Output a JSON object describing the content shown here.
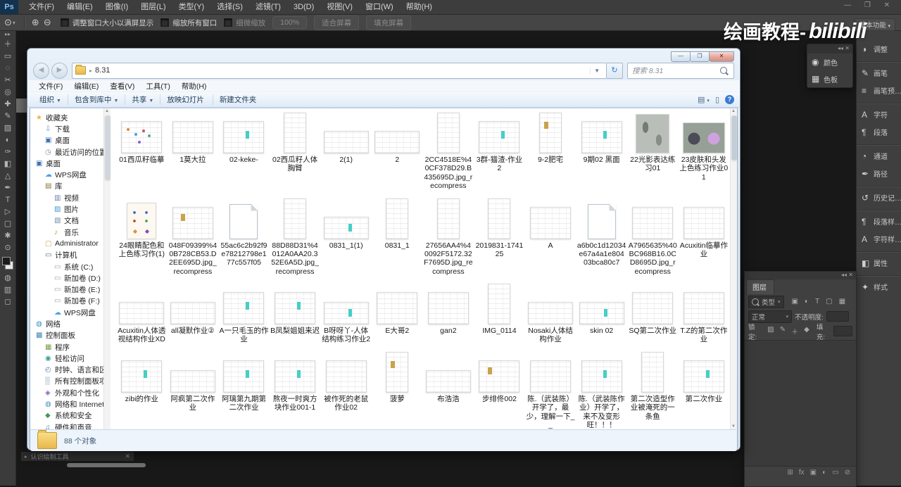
{
  "ps": {
    "logo": "Ps",
    "menus": [
      "文件(F)",
      "编辑(E)",
      "图像(I)",
      "图层(L)",
      "类型(Y)",
      "选择(S)",
      "滤镜(T)",
      "3D(D)",
      "视图(V)",
      "窗口(W)",
      "帮助(H)"
    ],
    "window_controls": "— ❐ ✕",
    "options": {
      "zoom_tool_icon": "⊙",
      "fit_window_label": "调整窗口大小以满屏显示",
      "zoom_all_label": "缩放所有窗口",
      "scrubby_label": "细微缩放",
      "btn_100": "100%",
      "btn_fit": "适合屏幕",
      "btn_fill": "填充屏幕"
    },
    "workspace": "基本功能",
    "tools_top": [
      "＋",
      "▭",
      "◌",
      "✂",
      "◎",
      "✚",
      "✎",
      "▨",
      "◐",
      "✑",
      "◧",
      "△",
      "✒",
      "T",
      "▷",
      "▢",
      "✱",
      "⊙"
    ],
    "tools_bottom": [
      "◍",
      "▥",
      "◻"
    ],
    "dock": [
      {
        "label": "调整",
        "glyph": "◑",
        "c": ""
      },
      {
        "label": "画笔",
        "glyph": "✎",
        "c": "sep"
      },
      {
        "label": "画笔预…",
        "glyph": "≡",
        "c": ""
      },
      {
        "label": "字符",
        "glyph": "A",
        "c": "sep"
      },
      {
        "label": "段落",
        "glyph": "¶",
        "c": ""
      },
      {
        "label": "通道",
        "glyph": "◔",
        "c": "sep"
      },
      {
        "label": "路径",
        "glyph": "✒",
        "c": ""
      },
      {
        "label": "历史记…",
        "glyph": "↺",
        "c": "sep"
      },
      {
        "label": "段落样…",
        "glyph": "¶",
        "c": "sep"
      },
      {
        "label": "字符样…",
        "glyph": "A",
        "c": ""
      },
      {
        "label": "属性",
        "glyph": "◧",
        "c": "sep"
      },
      {
        "label": "样式",
        "glyph": "✦",
        "c": "sep"
      }
    ],
    "float_panel": [
      {
        "label": "颜色",
        "glyph": "◉"
      },
      {
        "label": "色板",
        "glyph": "▦"
      }
    ],
    "layers": {
      "tab": "图层",
      "type_filter": "类型",
      "filter_icons": [
        "▣",
        "◐",
        "T",
        "▢",
        "▦"
      ],
      "blend_mode": "正常",
      "opacity_label": "不透明度:",
      "lock_label": "锁定:",
      "lock_icons": [
        "▨",
        "✎",
        "＋",
        "◆"
      ],
      "fill_label": "填充:",
      "footer_icons": [
        "⊞",
        "fx",
        "▣",
        "◐",
        "▭",
        "⊘"
      ]
    },
    "doc_tab": "认识绘制工具",
    "watermark": {
      "text": "绘画教程-",
      "logo": "bilibili"
    }
  },
  "explorer": {
    "address": "8.31",
    "search_placeholder": "搜索 8.31",
    "menus": [
      "文件(F)",
      "编辑(E)",
      "查看(V)",
      "工具(T)",
      "帮助(H)"
    ],
    "commands": [
      {
        "label": "组织",
        "arrow": "▼"
      },
      {
        "label": "包含到库中",
        "arrow": "▼"
      },
      {
        "label": "共享",
        "arrow": "▼"
      },
      {
        "label": "放映幻灯片",
        "arrow": ""
      },
      {
        "label": "新建文件夹",
        "arrow": ""
      }
    ],
    "sidebar": [
      {
        "label": "收藏夹",
        "glyph": "★",
        "color": "#e9b64a",
        "level": 0
      },
      {
        "label": "下载",
        "glyph": "⇩",
        "color": "#5a9ad6",
        "level": 1
      },
      {
        "label": "桌面",
        "glyph": "▣",
        "color": "#3f6fae",
        "level": 1
      },
      {
        "label": "最近访问的位置",
        "glyph": "◷",
        "color": "#7a8fa6",
        "level": 1
      },
      {
        "label": "桌面",
        "glyph": "▣",
        "color": "#3f6fae",
        "level": 0
      },
      {
        "label": "WPS网盘",
        "glyph": "☁",
        "color": "#4aa3e0",
        "level": 1
      },
      {
        "label": "库",
        "glyph": "▤",
        "color": "#8a6d3b",
        "level": 1
      },
      {
        "label": "视频",
        "glyph": "▥",
        "color": "#6a7fae",
        "level": 2
      },
      {
        "label": "图片",
        "glyph": "▨",
        "color": "#4a9ad0",
        "level": 2
      },
      {
        "label": "文档",
        "glyph": "▧",
        "color": "#7a8fa6",
        "level": 2
      },
      {
        "label": "音乐",
        "glyph": "♪",
        "color": "#c08a3e",
        "level": 2
      },
      {
        "label": "Administrator",
        "glyph": "▢",
        "color": "#caa54e",
        "level": 1
      },
      {
        "label": "计算机",
        "glyph": "▭",
        "color": "#5a6a7a",
        "level": 1
      },
      {
        "label": "系统 (C:)",
        "glyph": "▭",
        "color": "#9aa0a6",
        "level": 2
      },
      {
        "label": "新加卷 (D:)",
        "glyph": "▭",
        "color": "#9aa0a6",
        "level": 2
      },
      {
        "label": "新加卷 (E:)",
        "glyph": "▭",
        "color": "#9aa0a6",
        "level": 2
      },
      {
        "label": "新加卷 (F:)",
        "glyph": "▭",
        "color": "#9aa0a6",
        "level": 2
      },
      {
        "label": "WPS网盘",
        "glyph": "☁",
        "color": "#4aa3e0",
        "level": 2
      },
      {
        "label": "网络",
        "glyph": "◍",
        "color": "#3f8fc0",
        "level": 0
      },
      {
        "label": "控制面板",
        "glyph": "▩",
        "color": "#4a8ab0",
        "level": 0
      },
      {
        "label": "程序",
        "glyph": "▦",
        "color": "#7aa04a",
        "level": 1
      },
      {
        "label": "轻松访问",
        "glyph": "◉",
        "color": "#3f9c9c",
        "level": 1
      },
      {
        "label": "时钟、语言和区域",
        "glyph": "◴",
        "color": "#4a7ab0",
        "level": 1
      },
      {
        "label": "所有控制面板项",
        "glyph": "▒",
        "color": "#7a8fa6",
        "level": 1
      },
      {
        "label": "外观和个性化",
        "glyph": "◈",
        "color": "#8a5fc0",
        "level": 1
      },
      {
        "label": "网络和 Internet",
        "glyph": "◍",
        "color": "#3f8fc0",
        "level": 1
      },
      {
        "label": "系统和安全",
        "glyph": "◆",
        "color": "#4a9a5f",
        "level": 1
      },
      {
        "label": "硬件和声音",
        "glyph": "♫",
        "color": "#5a7a9a",
        "level": 1
      }
    ],
    "files": [
      {
        "n": "01西瓜籽临摹",
        "t": "w sp"
      },
      {
        "n": "1莫大拉",
        "t": "w"
      },
      {
        "n": "02-keke-",
        "t": "w tl"
      },
      {
        "n": "02西瓜籽人体胸臂",
        "t": "t"
      },
      {
        "n": "2(1)",
        "t": "ws"
      },
      {
        "n": "2",
        "t": "ws"
      },
      {
        "n": "2CC4518E%40CF378D29.B435695D.jpg_recompress",
        "t": "t"
      },
      {
        "n": "3群-猫渣-作业2",
        "t": "w tl"
      },
      {
        "n": "9-2肥宅",
        "t": "t au"
      },
      {
        "n": "9期02 黑面",
        "t": "w tl"
      },
      {
        "n": "22光影表达练习01",
        "t": "g"
      },
      {
        "n": "23皮肤和头发上色练习作业01",
        "t": "p"
      },
      {
        "n": "24眼睛配色和上色练习作(1)",
        "t": "e"
      },
      {
        "n": "048F09399%40B728CB53.D2EE695D.jpg_recompress",
        "t": "w au"
      },
      {
        "n": "55ac6c2b92f9e78212798e177c557f05",
        "t": "d"
      },
      {
        "n": "88D88D31%4012A0AA20.352E6A5D.jpg_recompress",
        "t": "t"
      },
      {
        "n": "0831_1(1)",
        "t": "ws tl"
      },
      {
        "n": "0831_1",
        "t": "t"
      },
      {
        "n": "27656AA4%40092F5172.32F7695D.jpg_recompress",
        "t": "t"
      },
      {
        "n": "2019831-174125",
        "t": "t"
      },
      {
        "n": "A",
        "t": "w"
      },
      {
        "n": "a6b0c1d12034e67a4a1e80403bca80c7",
        "t": "d"
      },
      {
        "n": "A7965635%40BC968B16.0CD8695D.jpg_recompress",
        "t": "w"
      },
      {
        "n": "Acuxitin临摹作业",
        "t": "w"
      },
      {
        "n": "Acuxitin人体透视结构作业XD",
        "t": "ws"
      },
      {
        "n": "all凝默作业②",
        "t": "ws"
      },
      {
        "n": "A一只毛玉的作业",
        "t": "w tl"
      },
      {
        "n": "B凤梨姐姐来迟",
        "t": "w tl"
      },
      {
        "n": "B呀呀丫-人体结构练习作业2",
        "t": "ws tl"
      },
      {
        "n": "E大哥2",
        "t": "w"
      },
      {
        "n": "gan2",
        "t": "w"
      },
      {
        "n": "IMG_0114",
        "t": "t"
      },
      {
        "n": "Nosaki人体结构作业",
        "t": "ws"
      },
      {
        "n": "skin 02",
        "t": "ws tl"
      },
      {
        "n": "SQ第二次作业",
        "t": "w"
      },
      {
        "n": "T.Z的第二次作业",
        "t": "w"
      },
      {
        "n": "zibi的作业",
        "t": "w tl"
      },
      {
        "n": "阿疯第二次作业",
        "t": "ws"
      },
      {
        "n": "阿璃第九期第二次作业",
        "t": "w tl"
      },
      {
        "n": "熬夜一时爽方块作业001-1",
        "t": "w tl"
      },
      {
        "n": "被作死的老鼠作业02",
        "t": "w"
      },
      {
        "n": "菠萝",
        "t": "t au"
      },
      {
        "n": "布浩浩",
        "t": "ws"
      },
      {
        "n": "步绯佟002",
        "t": "w au"
      },
      {
        "n": "陈.（武装陈）开学了，最少，理解一下__",
        "t": "w"
      },
      {
        "n": "陈.（武装陈作业）开学了，来不及变形旺！！！",
        "t": "w tl"
      },
      {
        "n": "第二次造型作业被淹死的一条鱼",
        "t": "t"
      },
      {
        "n": "第二次作业",
        "t": "w tl"
      },
      {
        "n": "",
        "t": "cut"
      },
      {
        "n": "",
        "t": "cut"
      },
      {
        "n": "",
        "t": "cut"
      },
      {
        "n": "",
        "t": "cut"
      },
      {
        "n": "",
        "t": "cut"
      },
      {
        "n": "",
        "t": "cut"
      },
      {
        "n": "",
        "t": "cut"
      }
    ],
    "status": "88 个对象"
  }
}
